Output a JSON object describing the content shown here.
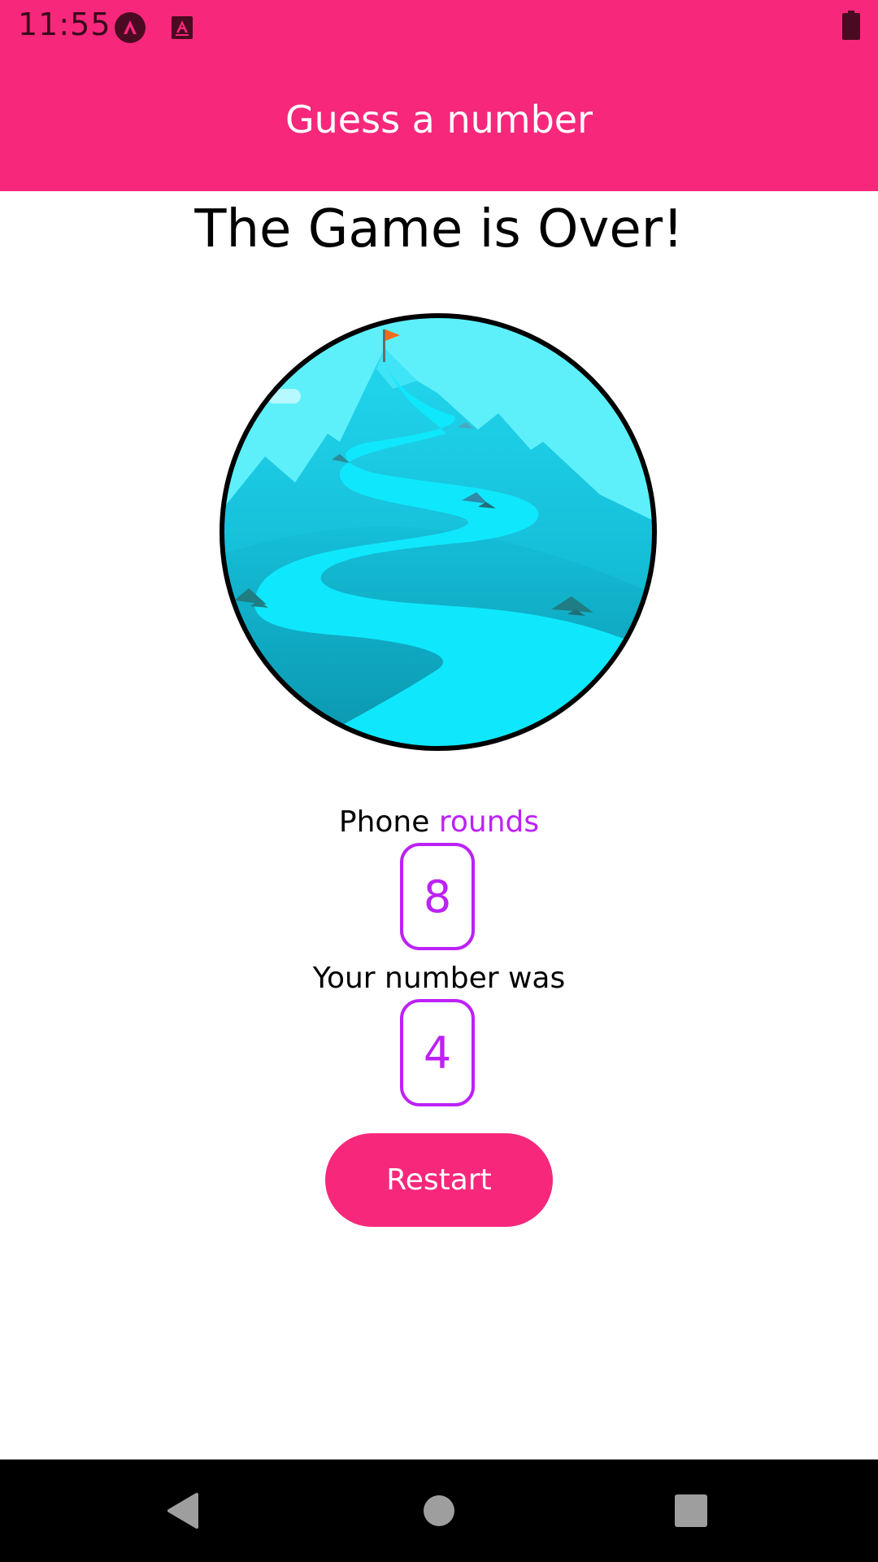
{
  "status_bar": {
    "time": "11:55",
    "icons": [
      "app-notification-icon",
      "accessibility-notification-icon",
      "battery-icon"
    ]
  },
  "app_bar": {
    "title": "Guess a number"
  },
  "game_over": {
    "title": "The Game is Over!",
    "image": "mountain-summit-illustration",
    "rounds_label_prefix": "Phone",
    "rounds_label_highlight": "rounds",
    "rounds_value": "8",
    "number_label": "Your number was",
    "number_value": "4",
    "restart_label": "Restart"
  },
  "nav_bar": {
    "buttons": [
      "back-icon",
      "home-icon",
      "recents-icon"
    ]
  },
  "colors": {
    "primary": "#F7287B",
    "accent": "#BD21F7",
    "background": "#FFFFFF",
    "nav_background": "#000000"
  }
}
